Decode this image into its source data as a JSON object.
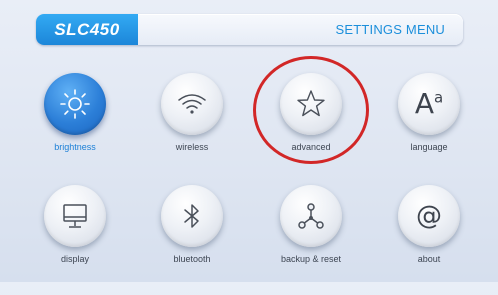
{
  "header": {
    "brand": "SLC450",
    "title": "SETTINGS MENU"
  },
  "menu": {
    "items": [
      {
        "label": "brightness",
        "icon": "sun-icon",
        "active": true
      },
      {
        "label": "wireless",
        "icon": "wifi-icon",
        "active": false
      },
      {
        "label": "advanced",
        "icon": "star-icon",
        "active": false
      },
      {
        "label": "language",
        "icon": "language-icon",
        "active": false
      },
      {
        "label": "display",
        "icon": "monitor-icon",
        "active": false
      },
      {
        "label": "bluetooth",
        "icon": "bluetooth-icon",
        "active": false
      },
      {
        "label": "backup & reset",
        "icon": "share-nodes-icon",
        "active": false
      },
      {
        "label": "about",
        "icon": "at-sign-icon",
        "active": false
      }
    ],
    "language_icon_glyph": "A",
    "language_icon_sup": "a",
    "about_icon_glyph": "@"
  },
  "colors": {
    "accent": "#1c8fdb",
    "active_label": "#1c7fd6",
    "highlight": "#d22727"
  }
}
